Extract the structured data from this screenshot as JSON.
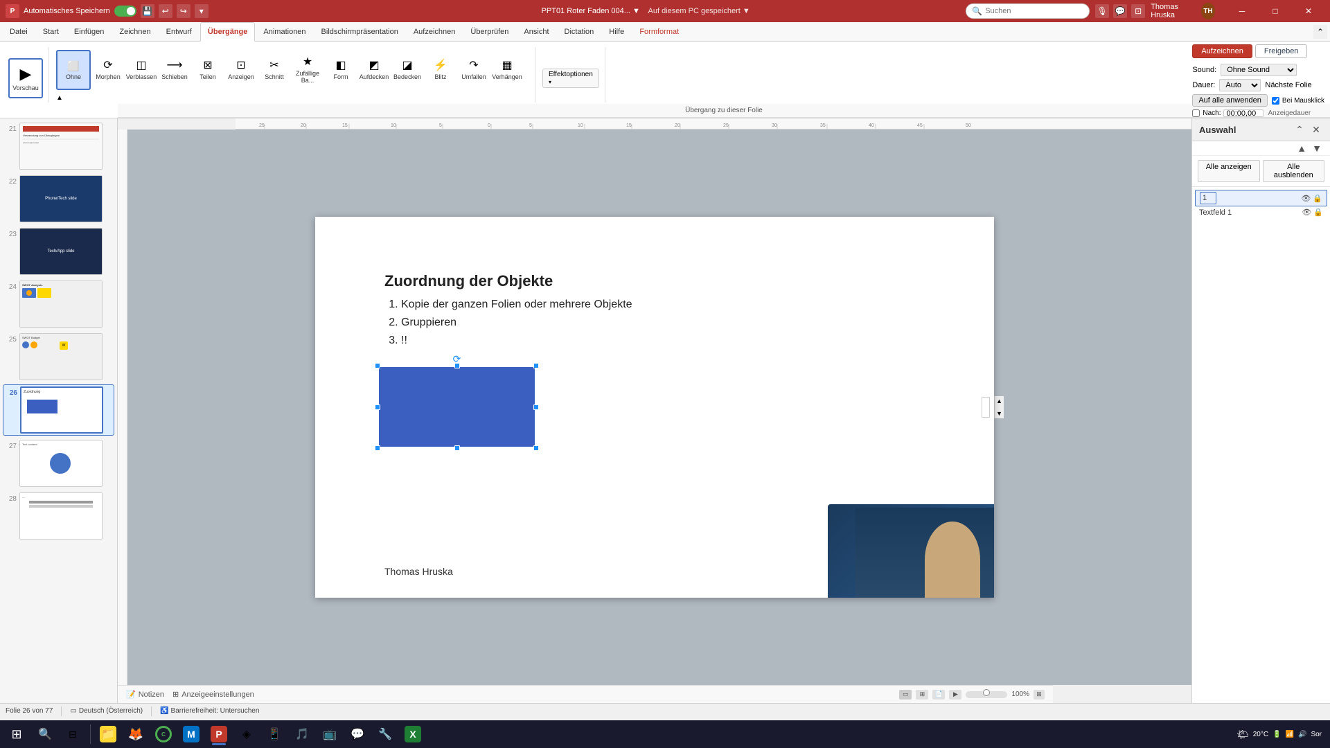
{
  "titlebar": {
    "autosave_label": "Automatisches Speichern",
    "file_name": "PPT01 Roter Faden 004... ▼",
    "save_location": "Auf diesem PC gespeichert ▼",
    "search_placeholder": "Suchen",
    "user_name": "Thomas Hruska",
    "user_initials": "TH",
    "window_min": "─",
    "window_max": "□",
    "window_close": "✕"
  },
  "ribbon": {
    "tabs": [
      {
        "label": "Datei",
        "active": false
      },
      {
        "label": "Start",
        "active": false
      },
      {
        "label": "Einfügen",
        "active": false
      },
      {
        "label": "Zeichnen",
        "active": false
      },
      {
        "label": "Entwurf",
        "active": false
      },
      {
        "label": "Übergänge",
        "active": true
      },
      {
        "label": "Animationen",
        "active": false
      },
      {
        "label": "Bildschirmpräsentation",
        "active": false
      },
      {
        "label": "Aufzeichnen",
        "active": false
      },
      {
        "label": "Überprüfen",
        "active": false
      },
      {
        "label": "Ansicht",
        "active": false
      },
      {
        "label": "Dictation",
        "active": false
      },
      {
        "label": "Hilfe",
        "active": false
      },
      {
        "label": "Formformat",
        "active": false
      }
    ],
    "transition_buttons": [
      {
        "icon": "▭",
        "label": "Vorschau",
        "large": true
      },
      {
        "icon": "▭",
        "label": "Ohne"
      },
      {
        "icon": "⊞",
        "label": "Morphen"
      },
      {
        "icon": "◫",
        "label": "Verblassen"
      },
      {
        "icon": "⊟",
        "label": "Schieben"
      },
      {
        "icon": "⊠",
        "label": "Teilen"
      },
      {
        "icon": "⊡",
        "label": "Anzeigen"
      },
      {
        "icon": "✂",
        "label": "Schnitt"
      },
      {
        "icon": "◈",
        "label": "Zufällige Ba..."
      },
      {
        "icon": "◧",
        "label": "Form"
      },
      {
        "icon": "◩",
        "label": "Aufdecken"
      },
      {
        "icon": "◪",
        "label": "Bedecken"
      },
      {
        "icon": "◫",
        "label": "Blitz"
      },
      {
        "icon": "⊛",
        "label": "Umfallen"
      },
      {
        "icon": "⊕",
        "label": "Verhängen"
      }
    ],
    "sound_label": "Sound:",
    "sound_value": "[Ohne Sound]",
    "duration_label": "Dauer:",
    "duration_value": "Auto",
    "next_slide_label": "Nächste Folie",
    "mouse_click_label": "Bei Mausklick",
    "after_label": "Nach:",
    "after_value": "00:00,00",
    "apply_all_label": "Auf alle anwenden",
    "effect_options_label": "Effektoptionen",
    "record_btn": "Aufzeichnen",
    "free_btn": "Freigeben",
    "übergang_label": "Übergang zu dieser Folie",
    "anzeigedauer_label": "Anzeigedauer"
  },
  "slide_panel": {
    "slides": [
      {
        "num": "21",
        "active": false,
        "star": false
      },
      {
        "num": "22",
        "active": false,
        "star": false
      },
      {
        "num": "23",
        "active": false,
        "star": false
      },
      {
        "num": "24",
        "active": false,
        "star": false
      },
      {
        "num": "25",
        "active": false,
        "star": false
      },
      {
        "num": "26",
        "active": true,
        "star": false
      },
      {
        "num": "27",
        "active": false,
        "star": true
      },
      {
        "num": "28",
        "active": false,
        "star": false
      }
    ]
  },
  "slide_content": {
    "title": "Zuordnung  der Objekte",
    "items": [
      "Kopie der ganzen Folien oder mehrere Objekte",
      "Gruppieren",
      "!!"
    ],
    "footer": "Thomas Hruska"
  },
  "right_panel": {
    "title": "Auswahl",
    "show_all_btn": "Alle anzeigen",
    "hide_all_btn": "Alle ausblenden",
    "items": [
      {
        "name": "Textfeld 1",
        "selected": false,
        "editing": true
      }
    ]
  },
  "status_bar": {
    "slide_info": "Folie 26 von 77",
    "language": "Deutsch (Österreich)",
    "accessibility": "Barrierefreiheit: Untersuchen",
    "notizen": "Notizen",
    "anzeige": "Anzeigeeinstellungen",
    "zoom_level": "100%"
  },
  "taskbar": {
    "time": "20°C",
    "apps": [
      {
        "icon": "⊞",
        "label": "Start",
        "color": "#0078d4"
      },
      {
        "icon": "🔍",
        "label": "Suche",
        "color": "#fff"
      },
      {
        "icon": "⊞",
        "label": "Aufgabenansicht",
        "color": "#4fc3f7"
      },
      {
        "icon": "📁",
        "label": "Datei-Explorer",
        "color": "#fdd835"
      },
      {
        "icon": "🦊",
        "label": "Firefox",
        "color": "#e65100"
      },
      {
        "icon": "◉",
        "label": "Chrome",
        "color": "#4caf50"
      },
      {
        "icon": "M",
        "label": "Outlook",
        "color": "#0072c6"
      },
      {
        "icon": "P",
        "label": "PowerPoint",
        "color": "#c0392b",
        "active": true
      },
      {
        "icon": "◈",
        "label": "App9",
        "color": "#555"
      },
      {
        "icon": "◉",
        "label": "App10",
        "color": "#888"
      },
      {
        "icon": "◈",
        "label": "App11",
        "color": "#4472C4"
      },
      {
        "icon": "◉",
        "label": "App12",
        "color": "#888"
      },
      {
        "icon": "◈",
        "label": "App13",
        "color": "#555"
      },
      {
        "icon": "X",
        "label": "Excel",
        "color": "#1e7e34"
      }
    ]
  }
}
